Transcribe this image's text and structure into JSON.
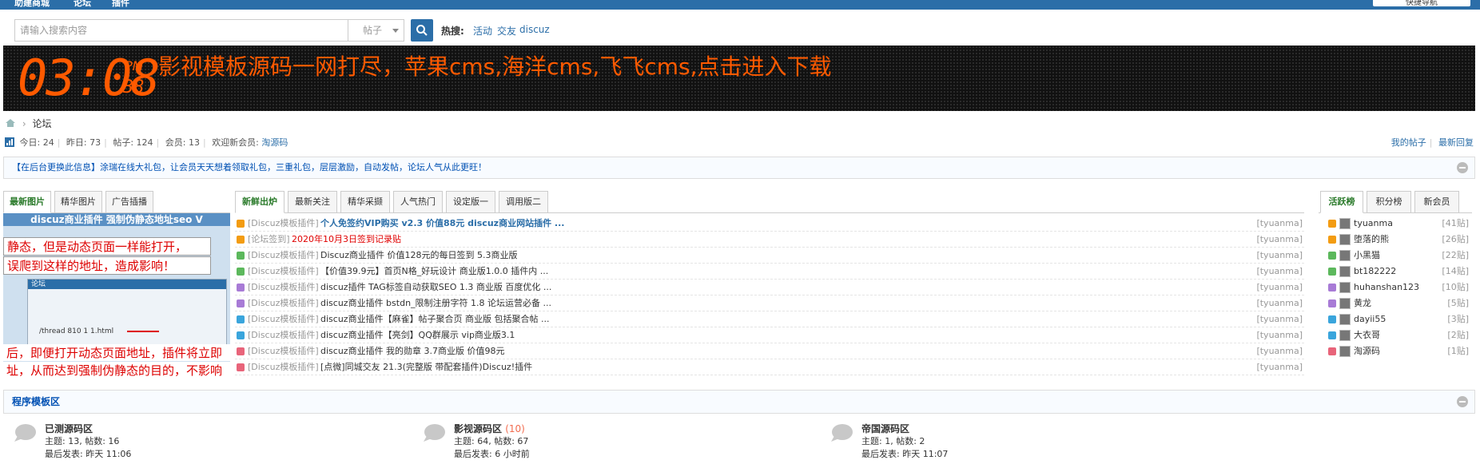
{
  "topnav": {
    "items": [
      "助建商城",
      "论坛",
      "插件"
    ],
    "quick_nav": "快捷导航"
  },
  "search": {
    "placeholder": "请输入搜索内容",
    "type": "帖子",
    "hot_label": "热搜:",
    "hot_items": [
      "活动",
      "交友",
      "discuz"
    ]
  },
  "banner": {
    "clock": "03:08",
    "ampm": "PM",
    "seconds": "38",
    "text": "影视模板源码一网打尽，苹果cms,海洋cms,飞飞cms,点击进入下载"
  },
  "breadcrumb": {
    "current": "论坛"
  },
  "stats": {
    "today": "今日: 24",
    "yesterday": "昨日: 73",
    "posts": "帖子: 124",
    "members": "会员: 13",
    "welcome": "欢迎新会员:",
    "new_member": "淘源码"
  },
  "right_links": {
    "my_posts": "我的帖子",
    "latest": "最新回复"
  },
  "announcement": "【在后台更换此信息】涂瑞在线大礼包，让会员天天想着领取礼包，三重礼包，层层激励，自动发帖，论坛人气从此更旺！",
  "left_tabs": [
    "最新图片",
    "精华图片",
    "广告插播"
  ],
  "mid_tabs": [
    "新鲜出炉",
    "最新关注",
    "精华采撷",
    "人气热门",
    "设定版一",
    "调用版二"
  ],
  "right_tabs": [
    "活跃榜",
    "积分榜",
    "新会员"
  ],
  "picture": {
    "title": "discuz商业插件 强制伪静态地址seo V",
    "line1": "静态，但是动态页面一样能打开，",
    "line2": "误爬到这样的地址，造成影响！",
    "forum_label": "论坛",
    "url_text": "/thread 810 1 1.html",
    "line3": "后，即便打开动态页面地址，插件将立即",
    "line4": "址，从而达到强制伪静态的目的，不影响"
  },
  "threads": [
    {
      "cat": "[Discuz模板插件]",
      "title": "个人免签约VIP购买 v2.3 价值88元 discuz商业网站插件 ...",
      "author": "[tyuanma]",
      "color": "#2b6ea8",
      "bold": true,
      "icon": "#f39c12"
    },
    {
      "cat": "[论坛签到]",
      "title": "2020年10月3日签到记录贴",
      "author": "[tyuanma]",
      "color": "#e00000",
      "bold": false,
      "icon": "#f39c12"
    },
    {
      "cat": "[Discuz模板插件]",
      "title": "Discuz商业插件 价值128元的每日签到 5.3商业版",
      "author": "[tyuanma]",
      "color": "#333333",
      "bold": false,
      "icon": "#5cb85c"
    },
    {
      "cat": "[Discuz模板插件]",
      "title": "【价值39.9元】首页N格_好玩设计 商业版1.0.0 插件内 ...",
      "author": "[tyuanma]",
      "color": "#333333",
      "bold": false,
      "icon": "#5cb85c"
    },
    {
      "cat": "[Discuz模板插件]",
      "title": "discuz插件 TAG标签自动获取SEO 1.3 商业版 百度优化 ...",
      "author": "[tyuanma]",
      "color": "#333333",
      "bold": false,
      "icon": "#a87bd6"
    },
    {
      "cat": "[Discuz模板插件]",
      "title": "discuz商业插件 bstdn_限制注册字符 1.8 论坛运营必备 ...",
      "author": "[tyuanma]",
      "color": "#333333",
      "bold": false,
      "icon": "#a87bd6"
    },
    {
      "cat": "[Discuz模板插件]",
      "title": "discuz商业插件【麻雀】帖子聚合页 商业版 包括聚合帖 ...",
      "author": "[tyuanma]",
      "color": "#333333",
      "bold": false,
      "icon": "#3aa5dc"
    },
    {
      "cat": "[Discuz模板插件]",
      "title": "discuz商业插件【亮剑】QQ群展示 vip商业版3.1",
      "author": "[tyuanma]",
      "color": "#333333",
      "bold": false,
      "icon": "#3aa5dc"
    },
    {
      "cat": "[Discuz模板插件]",
      "title": "discuz商业插件 我的勋章 3.7商业版 价值98元",
      "author": "[tyuanma]",
      "color": "#333333",
      "bold": false,
      "icon": "#e8647a"
    },
    {
      "cat": "[Discuz模板插件]",
      "title": "[点微]同城交友 21.3(完整版 带配套插件)Discuz!插件",
      "author": "[tyuanma]",
      "color": "#333333",
      "bold": false,
      "icon": "#e8647a"
    }
  ],
  "ranking": [
    {
      "name": "tyuanma",
      "count": "[41贴]",
      "icon": "#f39c12"
    },
    {
      "name": "堕落的熊",
      "count": "[26贴]",
      "icon": "#f39c12"
    },
    {
      "name": "小黑猫",
      "count": "[22贴]",
      "icon": "#5cb85c"
    },
    {
      "name": "bt182222",
      "count": "[14贴]",
      "icon": "#5cb85c"
    },
    {
      "name": "huhanshan123",
      "count": "[10贴]",
      "icon": "#a87bd6"
    },
    {
      "name": "黄龙",
      "count": "[5贴]",
      "icon": "#a87bd6"
    },
    {
      "name": "dayii55",
      "count": "[3贴]",
      "icon": "#3aa5dc"
    },
    {
      "name": "大衣哥",
      "count": "[2贴]",
      "icon": "#3aa5dc"
    },
    {
      "name": "淘源码",
      "count": "[1贴]",
      "icon": "#e8647a"
    }
  ],
  "zone": {
    "title": "程序模板区"
  },
  "forums": [
    {
      "name": "已测源码区",
      "new": "",
      "stats": "主题: 13, 帖数: 16",
      "last": "最后发表: 昨天 11:06"
    },
    {
      "name": "影视源码区",
      "new": "(10)",
      "stats": "主题: 64, 帖数: 67",
      "last": "最后发表: 6 小时前"
    },
    {
      "name": "帝国源码区",
      "new": "",
      "stats": "主题: 1, 帖数: 2",
      "last": "最后发表: 昨天 11:07"
    }
  ]
}
